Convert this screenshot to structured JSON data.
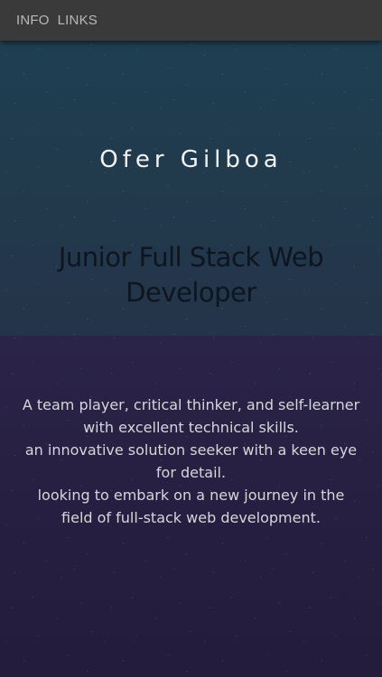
{
  "nav": {
    "items": [
      {
        "label": "INFO"
      },
      {
        "label": "LINKS"
      }
    ]
  },
  "hero": {
    "name": "Ofer Gilboa",
    "role": "Junior Full Stack Web Developer"
  },
  "about": {
    "lines": [
      "A team player, critical thinker, and self-learner with excellent technical skills.",
      "an innovative solution seeker with a keen eye for detail.",
      "looking to embark on a new journey in the field of full-stack web development."
    ]
  },
  "colors": {
    "navbar": "#3a3a3a",
    "hero_bg": "#213a4c",
    "about_bg": "#271f41",
    "name_text": "#f2f2f2",
    "role_text": "#0e1520",
    "bio_text": "#d6d6da"
  }
}
